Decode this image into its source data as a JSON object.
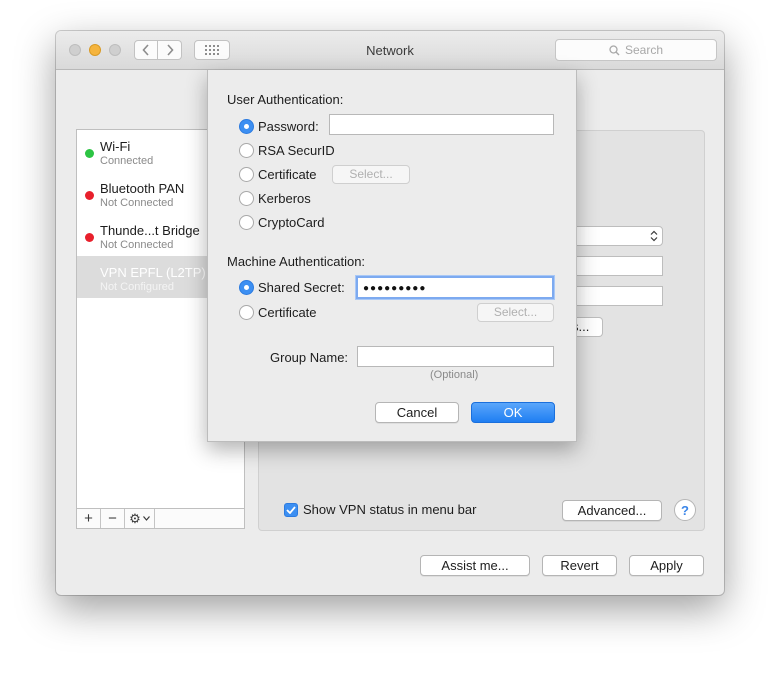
{
  "window": {
    "title": "Network"
  },
  "search": {
    "placeholder": "Search"
  },
  "services": [
    {
      "name": "Wi-Fi",
      "status": "Connected",
      "dot_color": "#2cc443"
    },
    {
      "name": "Bluetooth PAN",
      "status": "Not Connected",
      "dot_color": "#e8202c"
    },
    {
      "name": "Thunde...t Bridge",
      "status": "Not Connected",
      "dot_color": "#e8202c"
    },
    {
      "name": "VPN EPFL (L2TP)",
      "status": "Not Configured",
      "selected": true
    }
  ],
  "sidebar_tools": {
    "add": "+",
    "remove": "−",
    "gear": "⚙"
  },
  "panel": {
    "show_vpn_status_label": "Show VPN status in menu bar",
    "show_vpn_status_checked": true,
    "advanced_label": "Advanced...",
    "help_label": "?",
    "partial_button_text": "s..."
  },
  "footer": {
    "assist_label": "Assist me...",
    "revert_label": "Revert",
    "apply_label": "Apply"
  },
  "sheet": {
    "user_auth_title": "User Authentication:",
    "user_auth_options": [
      {
        "label": "Password:",
        "selected": true
      },
      {
        "label": "RSA SecurID",
        "selected": false
      },
      {
        "label": "Certificate",
        "selected": false
      },
      {
        "label": "Kerberos",
        "selected": false
      },
      {
        "label": "CryptoCard",
        "selected": false
      }
    ],
    "password_value": "",
    "user_cert_select_label": "Select...",
    "machine_auth_title": "Machine Authentication:",
    "machine_auth_options": [
      {
        "label": "Shared Secret:",
        "selected": true
      },
      {
        "label": "Certificate",
        "selected": false
      }
    ],
    "shared_secret_masked": "●●●●●●●●●",
    "machine_cert_select_label": "Select...",
    "group_name_label": "Group Name:",
    "group_name_value": "",
    "optional_label": "(Optional)",
    "cancel_label": "Cancel",
    "ok_label": "OK"
  },
  "colors": {
    "accent": "#3c8ff2",
    "selected_row": "#dcdcdc",
    "traffic_min": "#f5b43d"
  }
}
